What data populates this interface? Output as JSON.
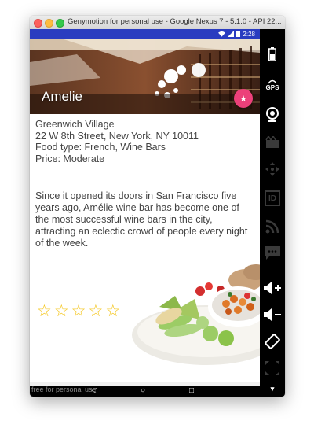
{
  "window": {
    "title": "Genymotion for personal use - Google Nexus 7 - 5.1.0 - API 22..."
  },
  "statusbar": {
    "time": "2:28"
  },
  "restaurant": {
    "name": "Amelie",
    "neighborhood": "Greenwich Village",
    "address": "22 W 8th Street, New York, NY  10011",
    "food_type": "Food type: French, Wine Bars",
    "price": "Price: Moderate",
    "description": "Since it opened its doors in San Francisco five years ago, Amélie wine bar has become one of the most successful wine bars in the city, attracting an eclectic crowd of people every night of the week."
  },
  "rating": {
    "value": 0,
    "max": 5,
    "icon": "star-outline-icon"
  },
  "fab": {
    "icon": "star-icon",
    "color": "#ec407a"
  },
  "sidepanel": {
    "gps_label": "GPS",
    "id_label": "ID",
    "icons": [
      "battery-icon",
      "gps-icon",
      "webcam-icon",
      "video-icon",
      "dpad-icon",
      "id-icon",
      "rss-icon",
      "sms-icon",
      "volume-up-icon",
      "volume-down-icon",
      "rotate-icon",
      "scale-icon",
      "menu-icon"
    ]
  },
  "navbar": {
    "watermark": "free for personal use",
    "back_glyph": "◁",
    "home_glyph": "○",
    "recents_glyph": "□"
  },
  "colors": {
    "statusbar": "#2a3cc0",
    "accent": "#ec407a",
    "star": "#f4c20d"
  }
}
